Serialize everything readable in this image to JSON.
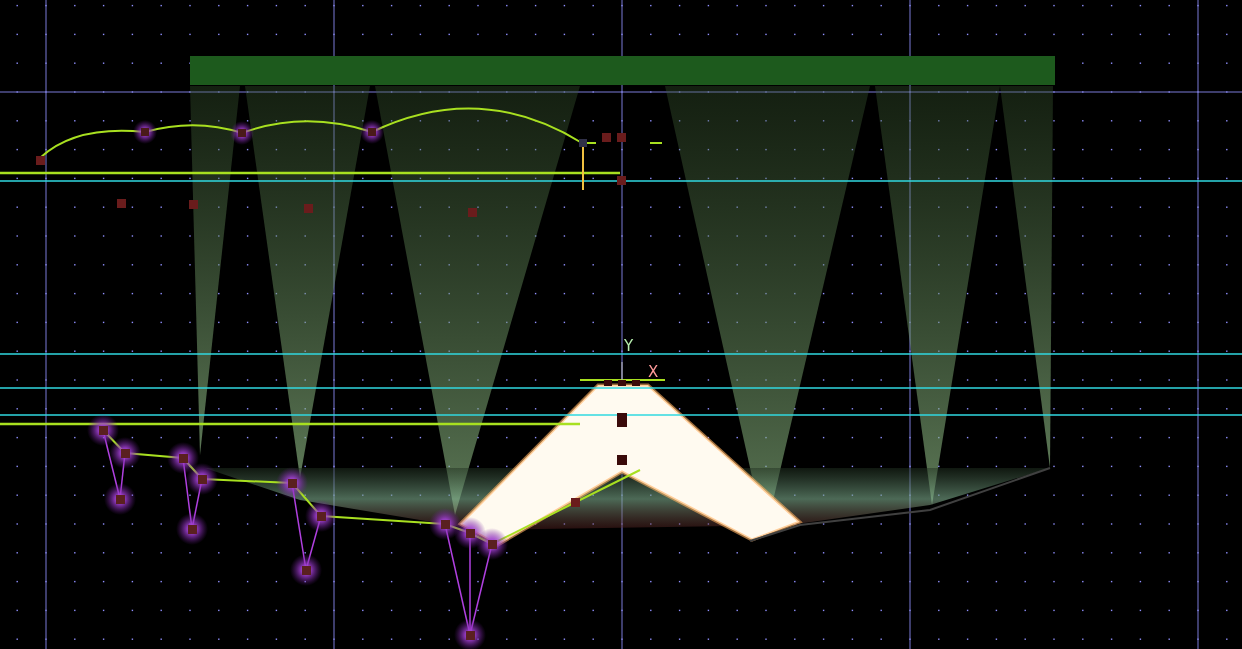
{
  "canvas": {
    "axis_labels": [
      {
        "kind": "y",
        "label": "Y"
      },
      {
        "kind": "x",
        "label": "X"
      }
    ]
  }
}
